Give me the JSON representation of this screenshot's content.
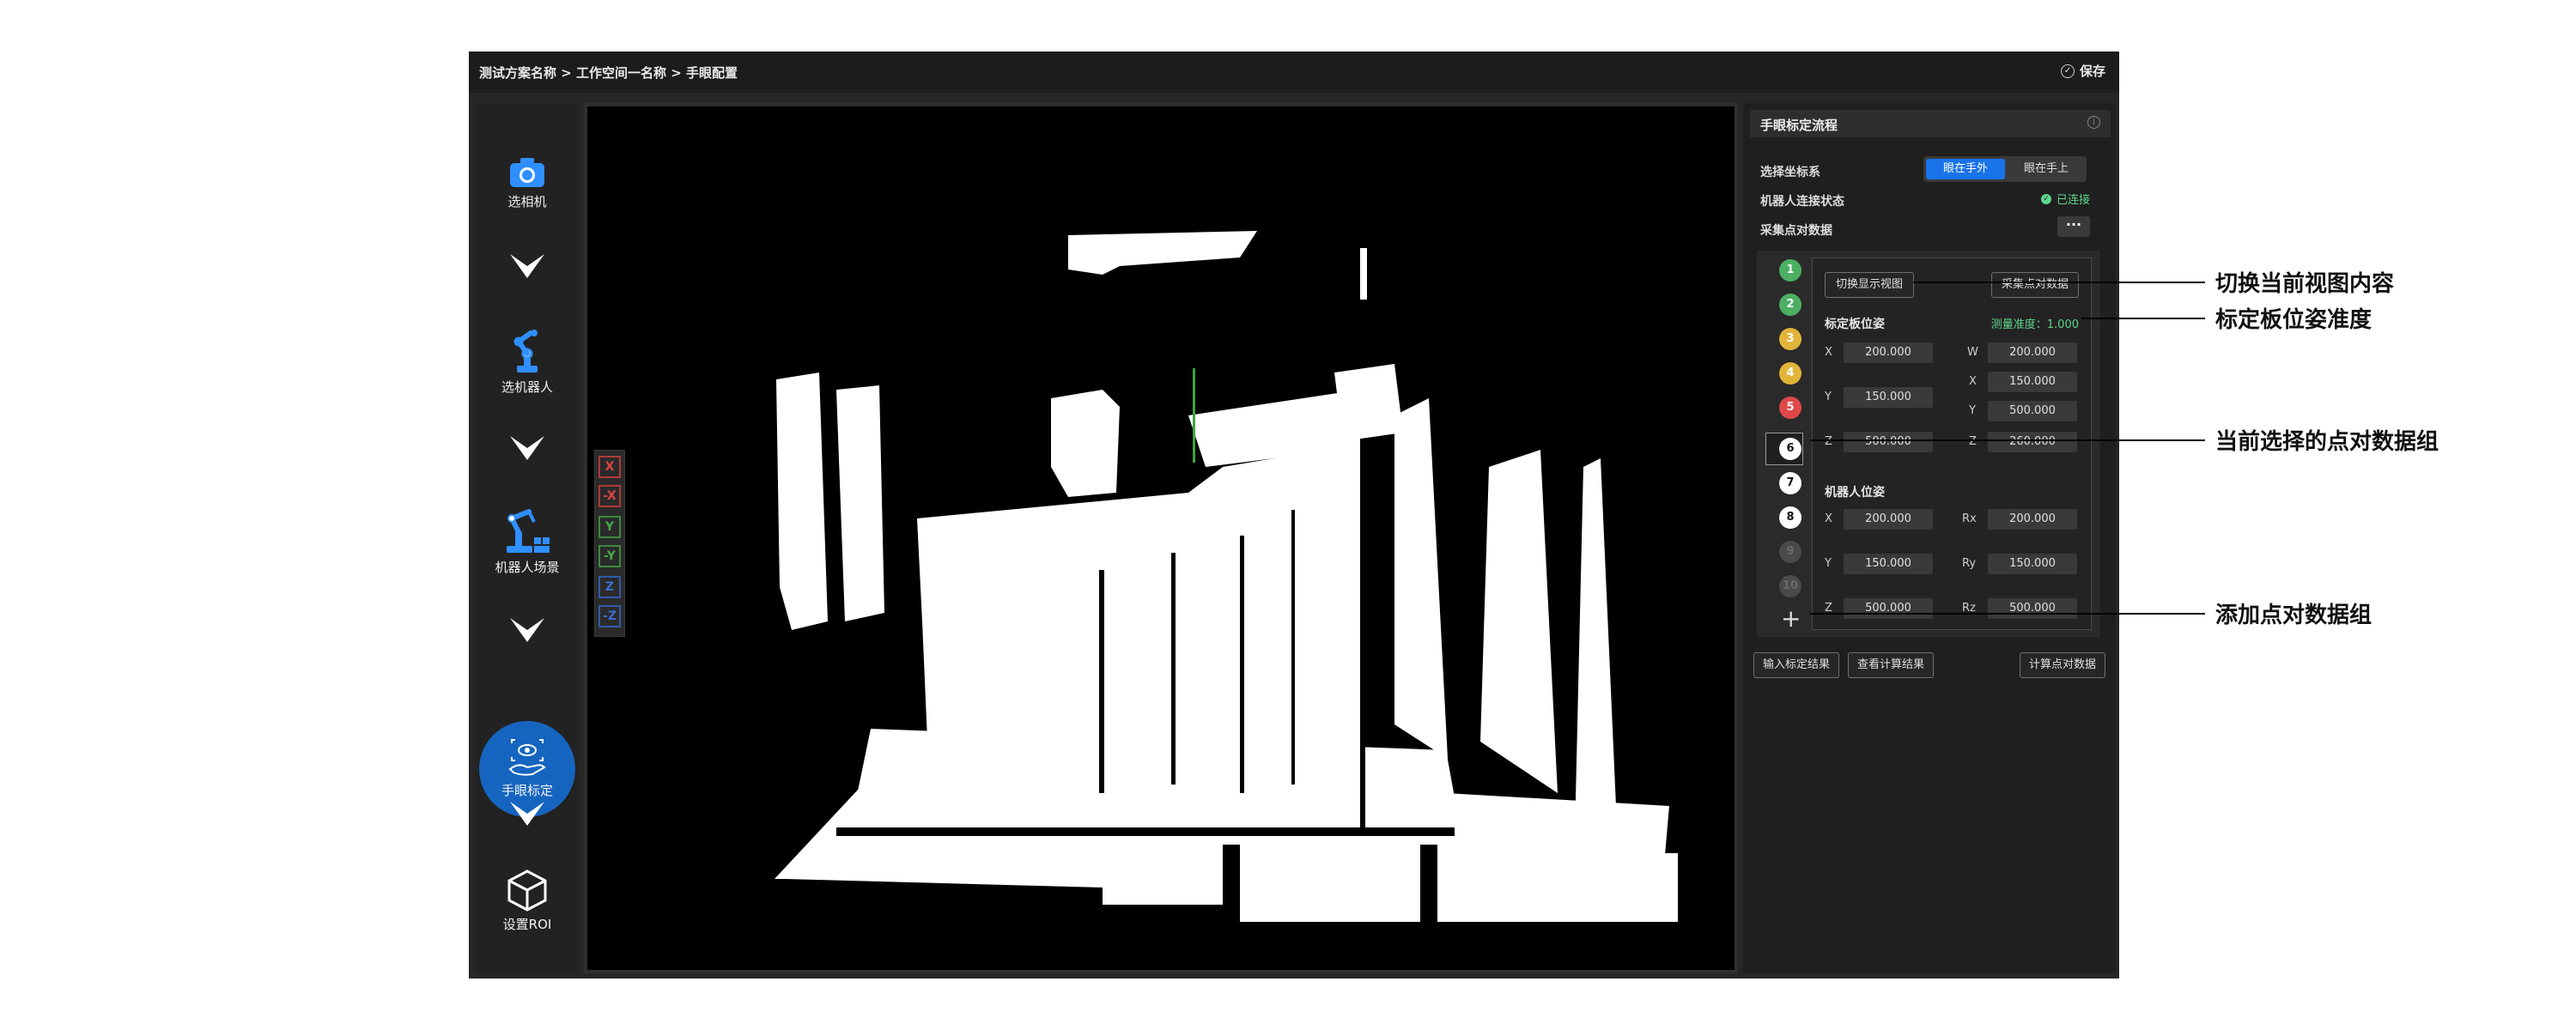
{
  "breadcrumb": "测试方案名称 > 工作空间一名称 > 手眼配置",
  "save_label": "保存",
  "sidebar": {
    "steps": [
      {
        "label": "选相机",
        "icon": "camera-icon"
      },
      {
        "label": "选机器人",
        "icon": "robot-arm-icon"
      },
      {
        "label": "机器人场景",
        "icon": "robot-scene-icon"
      },
      {
        "label": "手眼标定",
        "icon": "hand-eye-icon",
        "active": true
      },
      {
        "label": "设置ROI",
        "icon": "cube-icon"
      }
    ]
  },
  "viewport": {
    "axis_buttons": [
      "X",
      "-X",
      "Y",
      "-Y",
      "Z",
      "-Z"
    ],
    "axis_colors": {
      "x": "#e04444",
      "y": "#45a845",
      "z": "#3a6fd0"
    }
  },
  "panel": {
    "title": "手眼标定流程",
    "coord_label": "选择坐标系",
    "coord_options": [
      "眼在手外",
      "眼在手上"
    ],
    "robot_status_label": "机器人连接状态",
    "robot_status_value": "已连接",
    "collect_label": "采集点对数据",
    "more": "···",
    "points": [
      {
        "n": "1",
        "color": "#4caf63",
        "text": "#ffffff"
      },
      {
        "n": "2",
        "color": "#4caf63",
        "text": "#ffffff"
      },
      {
        "n": "3",
        "color": "#e2b43a",
        "text": "#ffffff"
      },
      {
        "n": "4",
        "color": "#e2b43a",
        "text": "#ffffff"
      },
      {
        "n": "5",
        "color": "#e04848",
        "text": "#ffffff"
      },
      {
        "n": "6",
        "color": "#ffffff",
        "text": "#111111"
      },
      {
        "n": "7",
        "color": "#ffffff",
        "text": "#111111"
      },
      {
        "n": "8",
        "color": "#ffffff",
        "text": "#111111"
      },
      {
        "n": "9",
        "color": "#4a4a4a",
        "text": "#6a6a6a"
      },
      {
        "n": "10",
        "color": "#4a4a4a",
        "text": "#6a6a6a"
      }
    ],
    "switch_view_btn": "切换显示视图",
    "collect_btn": "采集点对数据",
    "board_pose_label": "标定板位姿",
    "accuracy": "测量准度：1.000",
    "board": {
      "X": "200.000",
      "Y": "150.000",
      "Z": "500.000",
      "W": "200.000",
      "X2": "150.000",
      "Y2": "500.000",
      "Z2": "260.000"
    },
    "robot_pose_label": "机器人位姿",
    "robot": {
      "X": "200.000",
      "Y": "150.000",
      "Z": "500.000",
      "Rx": "200.000",
      "Ry": "150.000",
      "Rz": "500.000"
    },
    "bottom_buttons": [
      "输入标定结果",
      "查看计算结果",
      "计算点对数据"
    ]
  },
  "callouts": [
    "切换当前视图内容",
    "标定板位姿准度",
    "当前选择的点对数据组",
    "添加点对数据组"
  ]
}
